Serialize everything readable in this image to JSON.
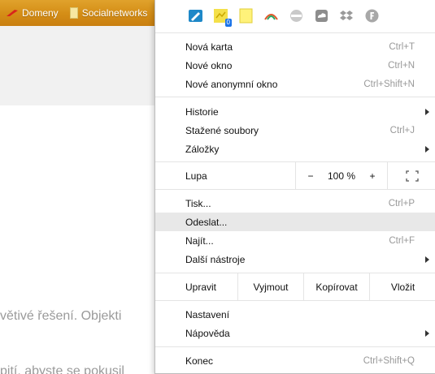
{
  "bookmarks": [
    {
      "label": "Domeny"
    },
    {
      "label": "Socialnetworks"
    }
  ],
  "page_text": {
    "line1": "větivé řešení. Objekti",
    "line2": "pití, abyste se pokusil"
  },
  "extensions": [
    {
      "icon": "paper-icon"
    },
    {
      "icon": "notes-icon",
      "badge": "0"
    },
    {
      "icon": "sticky-note-icon"
    },
    {
      "icon": "rainbow-icon"
    },
    {
      "icon": "globe-badge-icon"
    },
    {
      "icon": "cloud-upload-icon"
    },
    {
      "icon": "dropbox-icon"
    },
    {
      "icon": "f-circle-icon"
    }
  ],
  "menu": {
    "new_tab": {
      "label": "Nová karta",
      "shortcut": "Ctrl+T"
    },
    "new_window": {
      "label": "Nové okno",
      "shortcut": "Ctrl+N"
    },
    "new_incognito": {
      "label": "Nové anonymní okno",
      "shortcut": "Ctrl+Shift+N"
    },
    "history": {
      "label": "Historie"
    },
    "downloads": {
      "label": "Stažené soubory",
      "shortcut": "Ctrl+J"
    },
    "bookmarks": {
      "label": "Záložky"
    },
    "zoom": {
      "label": "Lupa",
      "minus": "−",
      "value": "100 %",
      "plus": "+"
    },
    "print": {
      "label": "Tisk...",
      "shortcut": "Ctrl+P"
    },
    "cast": {
      "label": "Odeslat..."
    },
    "find": {
      "label": "Najít...",
      "shortcut": "Ctrl+F"
    },
    "more_tools": {
      "label": "Další nástroje"
    },
    "edit": {
      "label": "Upravit",
      "cut": "Vyjmout",
      "copy": "Kopírovat",
      "paste": "Vložit"
    },
    "settings": {
      "label": "Nastavení"
    },
    "help": {
      "label": "Nápověda"
    },
    "exit": {
      "label": "Konec",
      "shortcut": "Ctrl+Shift+Q"
    }
  }
}
